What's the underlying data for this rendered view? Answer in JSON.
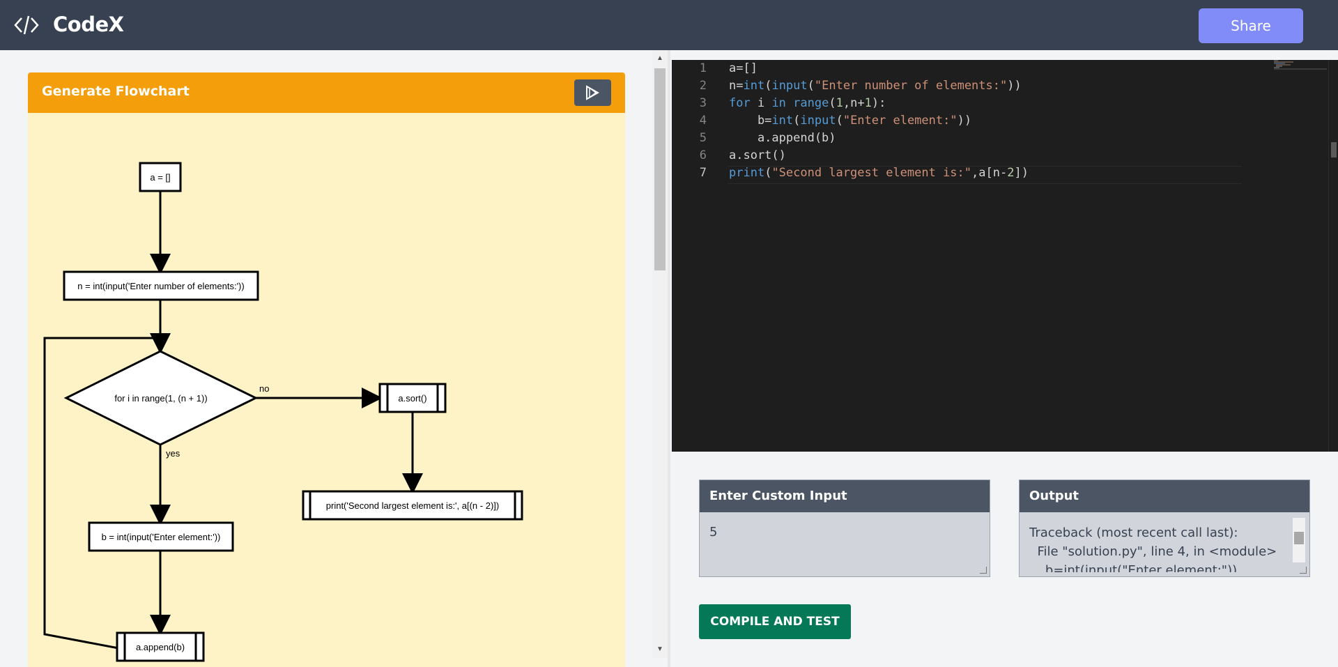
{
  "navbar": {
    "brand": "CodeX",
    "logo_icon": "code-brackets-icon",
    "share_label": "Share"
  },
  "flowchart_panel": {
    "title": "Generate Flowchart",
    "run_icon": "play-icon",
    "nodes": {
      "n1": "a = []",
      "n2": "n = int(input('Enter number of elements:'))",
      "n3": "for i in range(1, (n + 1))",
      "n4": "a.sort()",
      "n5": "print('Second largest element is:', a[(n - 2)])",
      "n6": "b = int(input('Enter element:'))",
      "n7": "a.append(b)"
    },
    "edge_labels": {
      "no": "no",
      "yes": "yes"
    }
  },
  "editor": {
    "line_numbers": [
      "1",
      "2",
      "3",
      "4",
      "5",
      "6",
      "7"
    ],
    "lines": [
      "a=[]",
      "n=int(input(\"Enter number of elements:\"))",
      "for i in range(1,n+1):",
      "    b=int(input(\"Enter element:\"))",
      "    a.append(b)",
      "a.sort()",
      "print(\"Second largest element is:\",a[n-2])"
    ]
  },
  "input_panel": {
    "title": "Enter Custom Input",
    "value": "5"
  },
  "output_panel": {
    "title": "Output",
    "text": "Traceback (most recent call last):\n  File \"solution.py\", line 4, in <module>\n    b=int(input(\"Enter element:\"))"
  },
  "compile_label": "COMPILE AND TEST",
  "colors": {
    "navbar": "#374151",
    "share": "#818cf8",
    "flowchart_header": "#f59e0b",
    "flowchart_bg": "#fef3c7",
    "editor_bg": "#1e1e1e",
    "compile": "#047857"
  }
}
